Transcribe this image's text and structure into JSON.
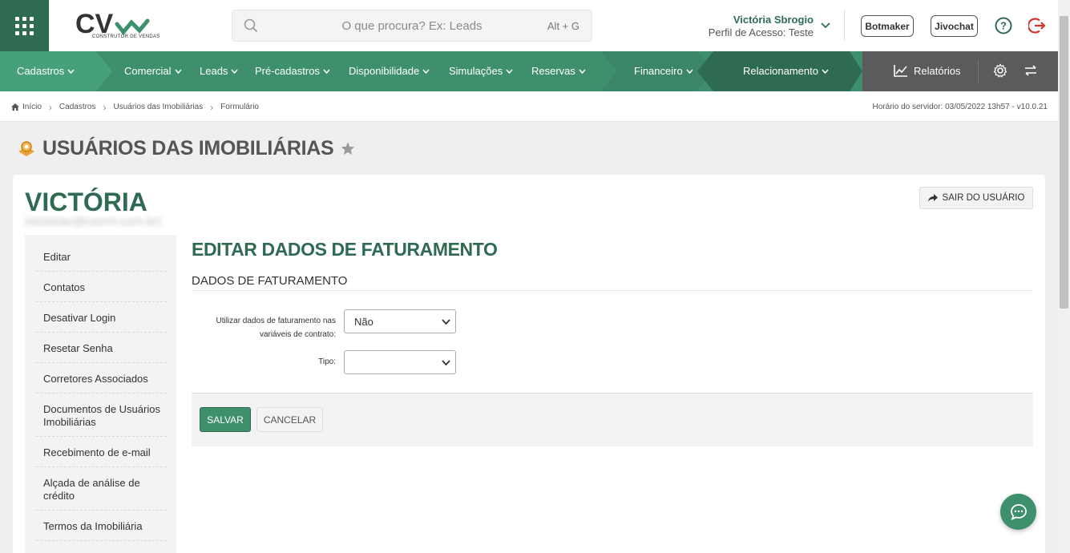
{
  "header": {
    "logo_sub": "CONSTRUTOR DE VENDAS",
    "search_placeholder": "O que procura? Ex: Leads",
    "search_shortcut": "Alt + G",
    "user_name": "Victória Sbrogio",
    "user_profile": "Perfil de Acesso: Teste",
    "botmaker_label": "Botmaker",
    "jivochat_label": "Jivochat"
  },
  "nav": {
    "items": [
      {
        "label": "Cadastros"
      },
      {
        "label": "Comercial"
      },
      {
        "label": "Leads"
      },
      {
        "label": "Pré-cadastros"
      },
      {
        "label": "Disponibilidade"
      },
      {
        "label": "Simulações"
      },
      {
        "label": "Reservas"
      },
      {
        "label": "Financeiro"
      },
      {
        "label": "Relacionamento"
      }
    ],
    "reports_label": "Relatórios",
    "colors": {
      "primary": "#3e8f6c",
      "dark": "#2f6b52",
      "gray": "#5b5b5b"
    }
  },
  "breadcrumb": {
    "items": [
      "Início",
      "Cadastros",
      "Usuários das Imobiliárias",
      "Formulário"
    ],
    "server_time": "Horário do servidor: 03/05/2022 13h57 - v10.0.21"
  },
  "page": {
    "title": "USUÁRIOS DAS IMOBILIÁRIAS",
    "user_first_name": "VICTÓRIA",
    "user_email": "(victoriac@cvcrm.com.br)",
    "exit_label": "SAIR DO USUÁRIO"
  },
  "sidemenu": {
    "items": [
      {
        "label": "Editar"
      },
      {
        "label": "Contatos"
      },
      {
        "label": "Desativar Login"
      },
      {
        "label": "Resetar Senha"
      },
      {
        "label": "Corretores Associados"
      },
      {
        "label": "Documentos de Usuários Imobiliárias"
      },
      {
        "label": "Recebimento de e-mail"
      },
      {
        "label": "Alçada de análise de crédito"
      },
      {
        "label": "Termos da Imobiliária"
      }
    ]
  },
  "form": {
    "title": "EDITAR DADOS DE FATURAMENTO",
    "subtitle": "DADOS DE FATURAMENTO",
    "use_billing_label": "Utilizar dados de faturamento nas variáveis de contrato:",
    "use_billing_value": "Não",
    "type_label": "Tipo:",
    "type_value": "",
    "save_label": "SALVAR",
    "cancel_label": "CANCELAR"
  }
}
